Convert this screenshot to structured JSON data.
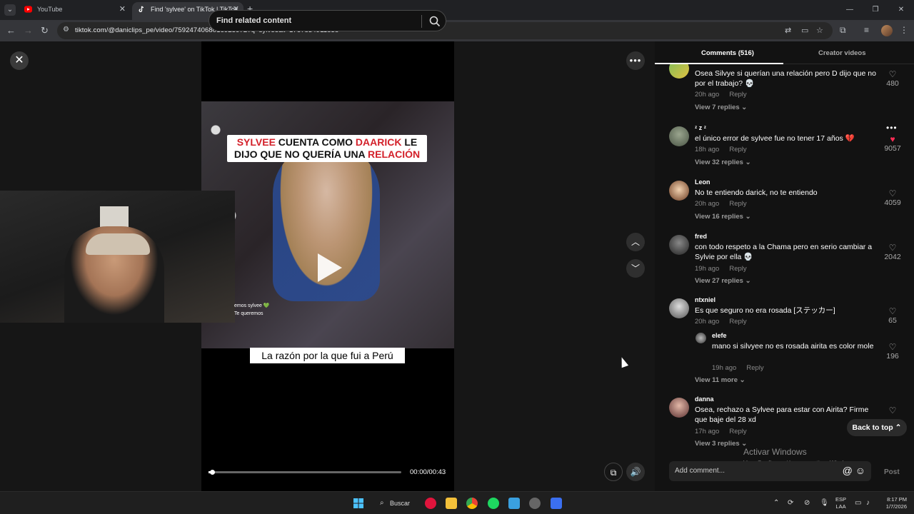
{
  "browser": {
    "tabs": [
      {
        "title": "YouTube",
        "active": false
      },
      {
        "title": "Find 'sylvee' on TikTok | TikTok",
        "active": true
      }
    ],
    "url": "tiktok.com/@daniclips_pe/video/7592474068016925972?q=sylvee&t=1767834911838"
  },
  "video": {
    "search_placeholder": "Find related content",
    "title_parts": [
      "SYLVEE",
      " CUENTA COMO ",
      "DAARICK",
      " LE DIJO QUE NO QUERÍA UNA ",
      "RELACIÓN"
    ],
    "caption": "La razón por la que fui a Perú",
    "cam_text_1": "emos sylvee 💚",
    "cam_text_2": "Te queremos",
    "timecode": "00:00/00:43",
    "progress": 0.02
  },
  "panel": {
    "tab_comments": "Comments (516)",
    "tab_creator": "Creator videos",
    "back_to_top": "Back to top",
    "add_comment_placeholder": "Add comment...",
    "post_label": "Post",
    "watermark_1": "Activar Windows",
    "watermark_2": "Ve a Configuración para activar Windows."
  },
  "comments": [
    {
      "user": "",
      "text": "Osea Silvye si querían una relación pero D dijo que no por el trabajo? 💀",
      "time": "20h ago",
      "reply": "Reply",
      "likes": "480",
      "more": "View 7 replies",
      "liked": false
    },
    {
      "user": "ᶻ z ᶻ",
      "text": "el único error de sylvee fue no tener 17 años 💔",
      "time": "18h ago",
      "reply": "Reply",
      "likes": "9057",
      "more": "View 32 replies",
      "liked": true
    },
    {
      "user": "Leon",
      "text": "No te entiendo darick, no te entiendo",
      "time": "20h ago",
      "reply": "Reply",
      "likes": "4059",
      "more": "View 16 replies",
      "liked": false
    },
    {
      "user": "fred",
      "text": "con todo respeto a la Chama pero en serio cambiar a Sylvie por ella 💀",
      "time": "19h ago",
      "reply": "Reply",
      "likes": "2042",
      "more": "View 27 replies",
      "liked": false
    },
    {
      "user": "ntxniel",
      "text": "Es que seguro no era rosada [ステッカー]",
      "time": "20h ago",
      "reply": "Reply",
      "likes": "65",
      "more": "",
      "liked": false
    },
    {
      "user": "elefe",
      "text": "mano si silvyee no es rosada airita es color mole",
      "time": "19h ago",
      "reply": "Reply",
      "likes": "196",
      "more": "View 11 more",
      "liked": false
    },
    {
      "user": "danna",
      "text": "Osea, rechazo a Sylvee para estar con Airita? Firme que baje del 28 xd",
      "time": "17h ago",
      "reply": "Reply",
      "likes": "",
      "more": "View 3 replies",
      "liked": false
    }
  ],
  "taskbar": {
    "search": "Buscar",
    "lang_1": "ESP",
    "lang_2": "LAA",
    "time": "8:17 PM",
    "date": "1/7/2026"
  }
}
